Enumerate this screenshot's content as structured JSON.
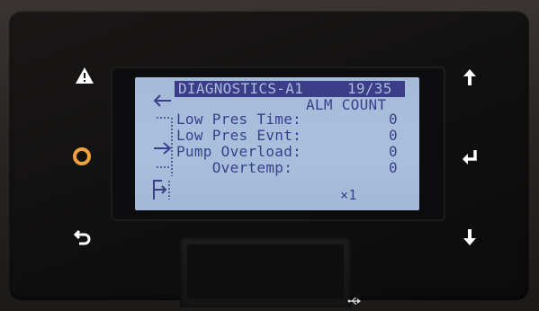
{
  "screen": {
    "title": "DIAGNOSTICS-A1",
    "page_indicator": "19/35",
    "column_header": "ALM COUNT",
    "rows": [
      {
        "label": "Low Pres Time:",
        "value": "0"
      },
      {
        "label": "Low Pres Evnt:",
        "value": "0"
      },
      {
        "label": "Pump Overload:",
        "value": "0"
      },
      {
        "label": "    Overtemp:",
        "value": "0"
      }
    ],
    "multiplier": "×1"
  },
  "buttons": {
    "alarm": {
      "icon": "warning-triangle-icon"
    },
    "prg": {
      "icon": "ring-icon",
      "color": "#f2a23a"
    },
    "escape": {
      "icon": "back-arrow-icon"
    },
    "up": {
      "icon": "arrow-up-icon"
    },
    "enter": {
      "icon": "enter-arrow-icon"
    },
    "down": {
      "icon": "arrow-down-icon"
    }
  },
  "colors": {
    "lcd_background": "#a7bcda",
    "lcd_text": "#3a3f8c",
    "bezel": "#111010",
    "button_icon": "#ffffff"
  },
  "device": {
    "usb_symbol": "usb-icon"
  }
}
